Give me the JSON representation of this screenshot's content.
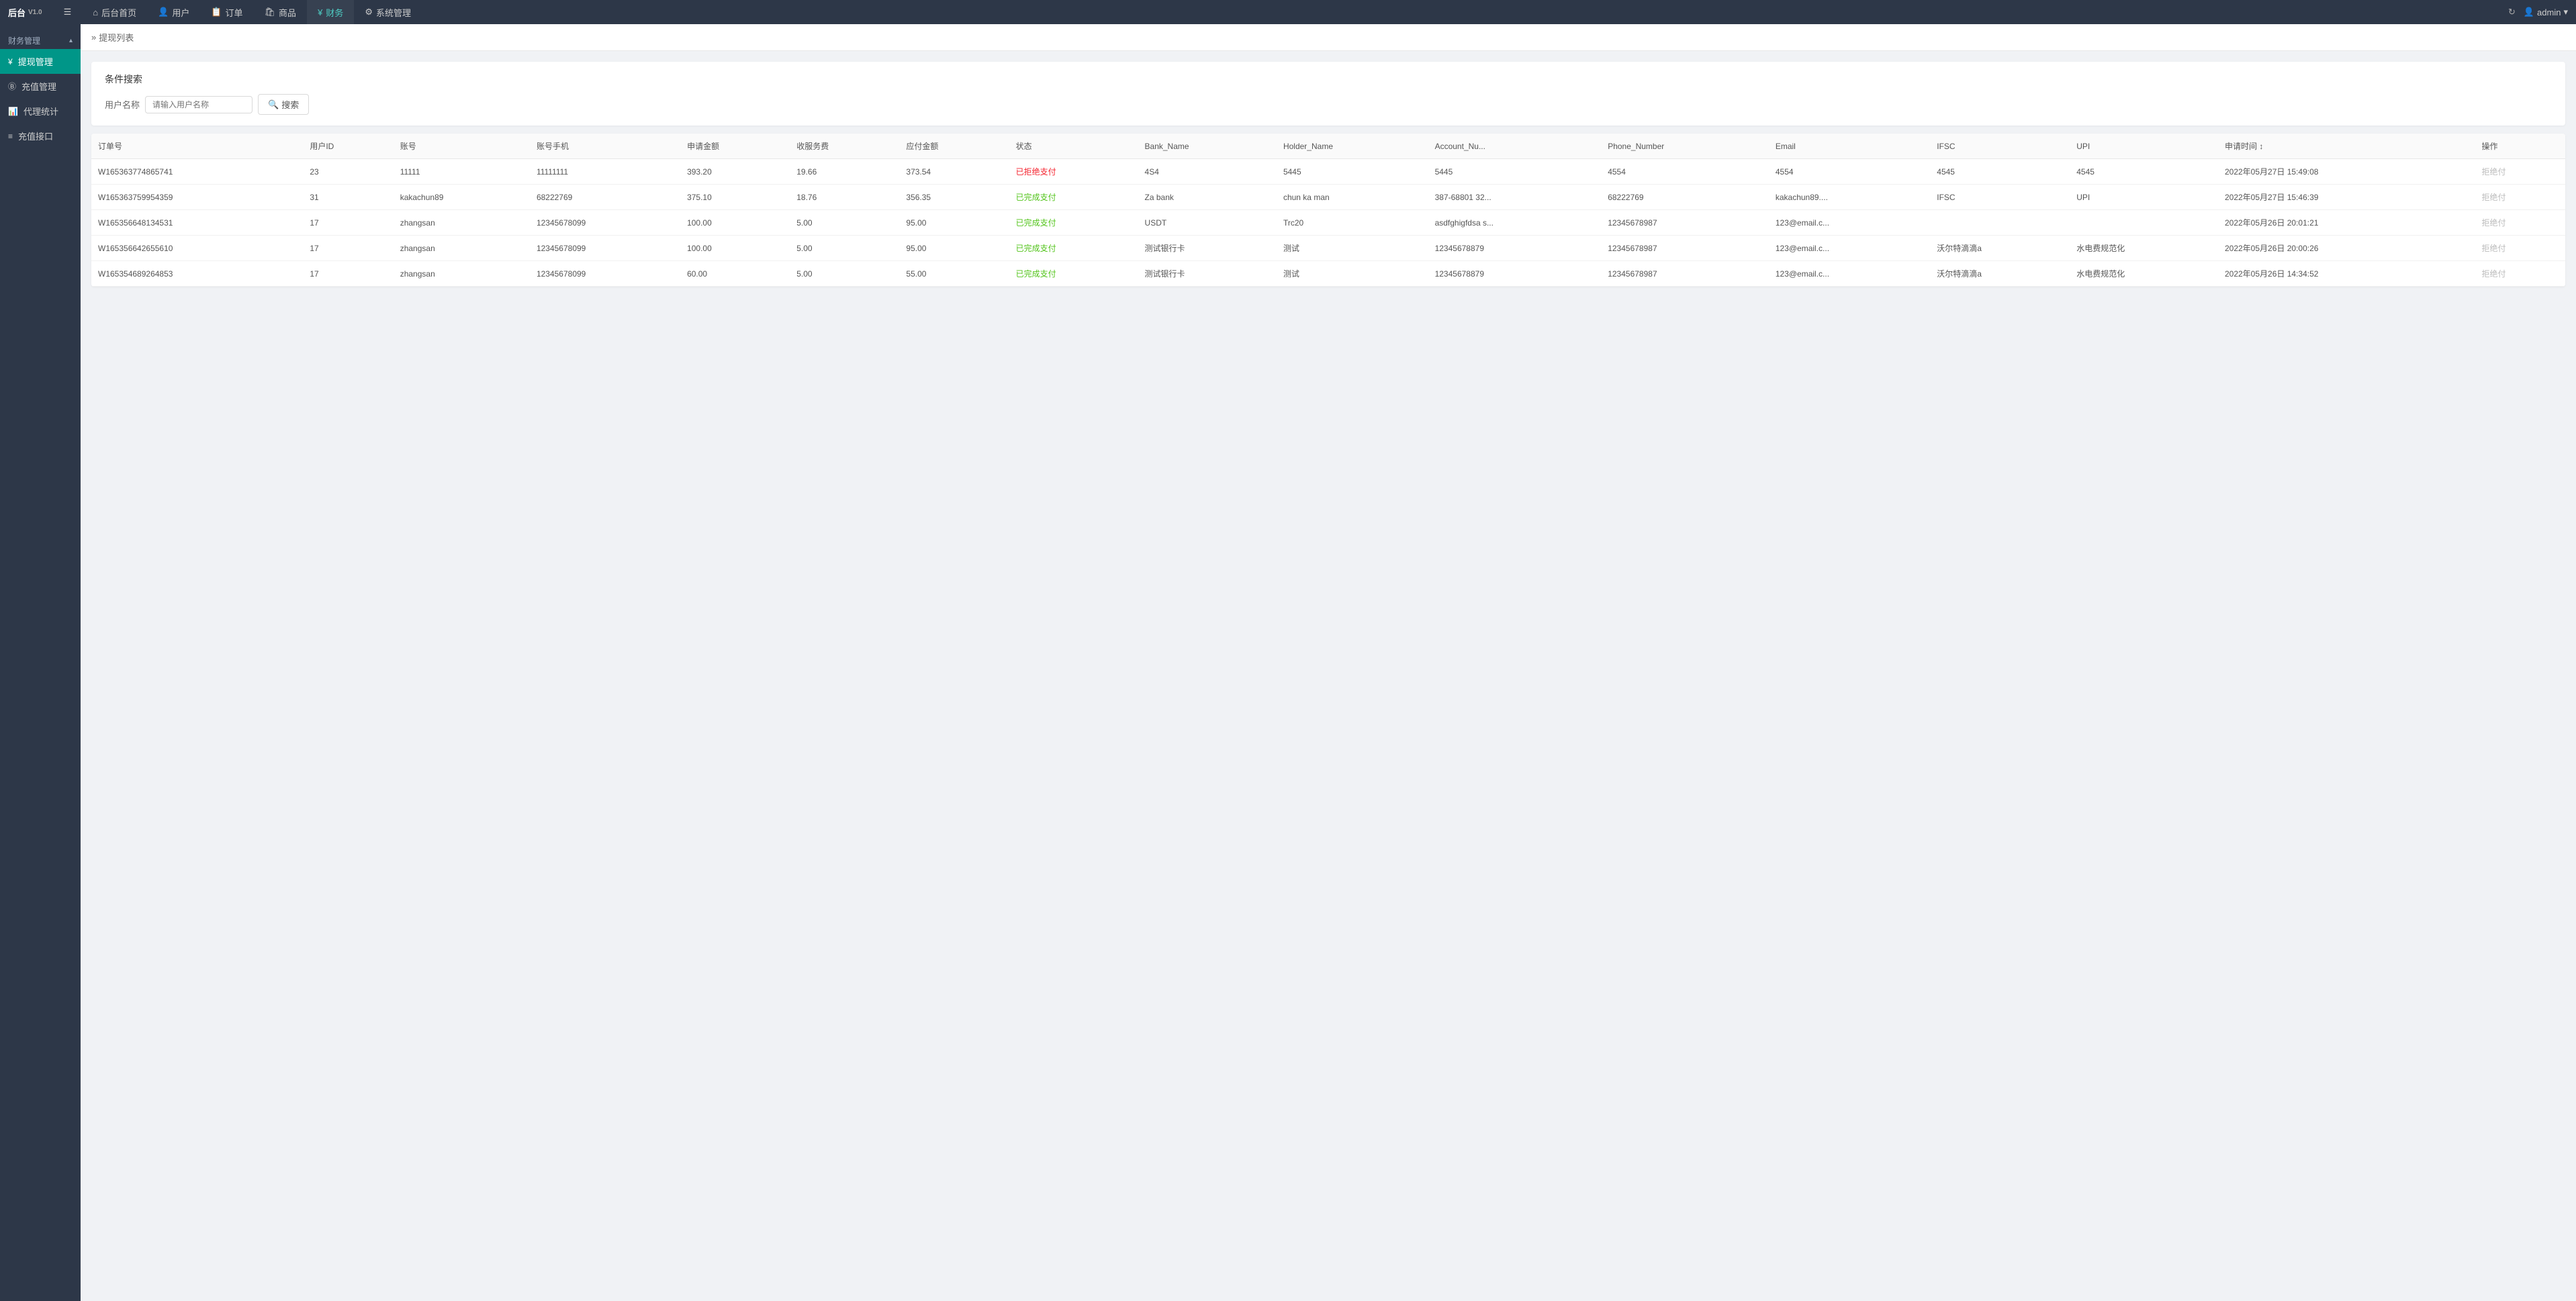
{
  "app": {
    "name": "后台",
    "version": "V1.0"
  },
  "topNav": {
    "items": [
      {
        "id": "menu-toggle",
        "label": "≡",
        "icon": "menu-icon"
      },
      {
        "id": "home",
        "label": "后台首页",
        "icon": "home-icon"
      },
      {
        "id": "users",
        "label": "用户",
        "icon": "user-icon"
      },
      {
        "id": "orders",
        "label": "订单",
        "icon": "order-icon"
      },
      {
        "id": "goods",
        "label": "商品",
        "icon": "goods-icon"
      },
      {
        "id": "finance",
        "label": "财务",
        "icon": "finance-icon",
        "active": true
      },
      {
        "id": "system",
        "label": "系统管理",
        "icon": "system-icon"
      }
    ],
    "right": {
      "refresh": "↻",
      "admin_label": "admin"
    }
  },
  "sidebar": {
    "group_title": "财务管理",
    "items": [
      {
        "id": "withdrawal",
        "label": "提现管理",
        "icon": "¥",
        "active": true
      },
      {
        "id": "recharge",
        "label": "充值管理",
        "icon": "B"
      },
      {
        "id": "agent-stats",
        "label": "代理统计",
        "icon": "📊"
      },
      {
        "id": "recharge-api",
        "label": "充值接口",
        "icon": "≡"
      }
    ]
  },
  "breadcrumb": {
    "separator": "»",
    "current": "提现列表"
  },
  "search": {
    "title": "条件搜索",
    "username_label": "用户名称",
    "username_placeholder": "请输入用户名称",
    "search_btn": "搜索"
  },
  "table": {
    "columns": [
      "订单号",
      "用户ID",
      "账号",
      "账号手机",
      "申请金额",
      "收服务费",
      "应付金额",
      "状态",
      "Bank_Name",
      "Holder_Name",
      "Account_Nu...",
      "Phone_Number",
      "Email",
      "IFSC",
      "UPI",
      "申请时间",
      "操作"
    ],
    "rows": [
      {
        "order_id": "W165363774865741",
        "user_id": "23",
        "account": "11111",
        "phone": "11111111",
        "apply_amount": "393.20",
        "service_fee": "19.66",
        "payable": "373.54",
        "status": "已拒绝支付",
        "status_type": "red",
        "bank_name": "4S4",
        "holder_name": "5445",
        "account_no": "5445",
        "phone_number": "4554",
        "email": "4554",
        "ifsc": "4545",
        "upi": "4545",
        "apply_time": "2022年05月27日 15:49:08",
        "action": "拒绝付"
      },
      {
        "order_id": "W165363759954359",
        "user_id": "31",
        "account": "kakachun89",
        "phone": "68222769",
        "apply_amount": "375.10",
        "service_fee": "18.76",
        "payable": "356.35",
        "status": "已完成支付",
        "status_type": "green",
        "bank_name": "Za bank",
        "holder_name": "chun ka man",
        "account_no": "387-68801 32...",
        "phone_number": "68222769",
        "email": "kakachun89....",
        "ifsc": "IFSC",
        "upi": "UPI",
        "apply_time": "2022年05月27日 15:46:39",
        "action": "拒绝付"
      },
      {
        "order_id": "W165356648134531",
        "user_id": "17",
        "account": "zhangsan",
        "phone": "12345678099",
        "apply_amount": "100.00",
        "service_fee": "5.00",
        "payable": "95.00",
        "status": "已完成支付",
        "status_type": "green",
        "bank_name": "USDT",
        "holder_name": "Trc20",
        "account_no": "asdfghigfdsa s...",
        "phone_number": "12345678987",
        "email": "123@email.c...",
        "ifsc": "",
        "upi": "",
        "apply_time": "2022年05月26日 20:01:21",
        "action": "拒绝付"
      },
      {
        "order_id": "W165356642655610",
        "user_id": "17",
        "account": "zhangsan",
        "phone": "12345678099",
        "apply_amount": "100.00",
        "service_fee": "5.00",
        "payable": "95.00",
        "status": "已完成支付",
        "status_type": "green",
        "bank_name": "测试银行卡",
        "holder_name": "测试",
        "account_no": "12345678879",
        "phone_number": "12345678987",
        "email": "123@email.c...",
        "ifsc": "沃尔特滴滴a",
        "upi": "水电费规范化",
        "apply_time": "2022年05月26日 20:00:26",
        "action": "拒绝付"
      },
      {
        "order_id": "W165354689264853",
        "user_id": "17",
        "account": "zhangsan",
        "phone": "12345678099",
        "apply_amount": "60.00",
        "service_fee": "5.00",
        "payable": "55.00",
        "status": "已完成支付",
        "status_type": "green",
        "bank_name": "测试银行卡",
        "holder_name": "测试",
        "account_no": "12345678879",
        "phone_number": "12345678987",
        "email": "123@email.c...",
        "ifsc": "沃尔特滴滴a",
        "upi": "水电费规范化",
        "apply_time": "2022年05月26日 14:34:52",
        "action": "拒绝付"
      }
    ]
  }
}
